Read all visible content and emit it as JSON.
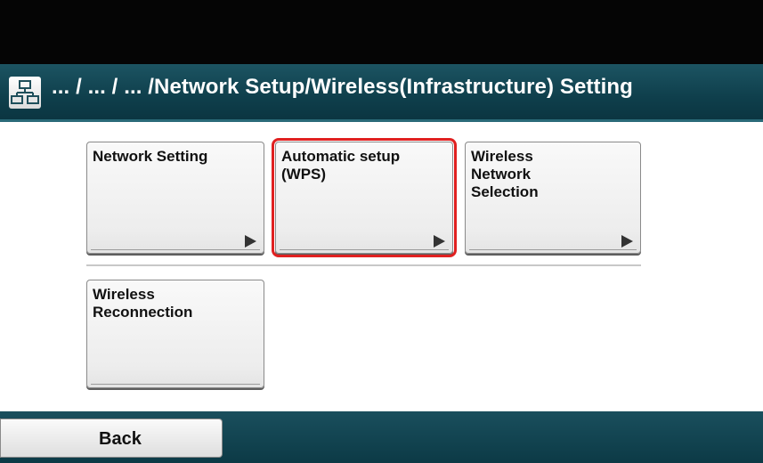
{
  "header": {
    "breadcrumb": "... / ... / ... /Network Setup/Wireless(Infrastructure) Setting",
    "icon": "network-icon"
  },
  "menu": {
    "items": [
      {
        "label": "Network Setting",
        "selected": false
      },
      {
        "label": "Automatic setup\n(WPS)",
        "selected": true
      },
      {
        "label": "Wireless\nNetwork\nSelection",
        "selected": false
      },
      {
        "label": "Wireless\nReconnection",
        "selected": false
      }
    ]
  },
  "footer": {
    "back_label": "Back"
  },
  "colors": {
    "title_bar": "#0f3f4c",
    "selection": "#e02020",
    "tile": "#eeeeee"
  }
}
